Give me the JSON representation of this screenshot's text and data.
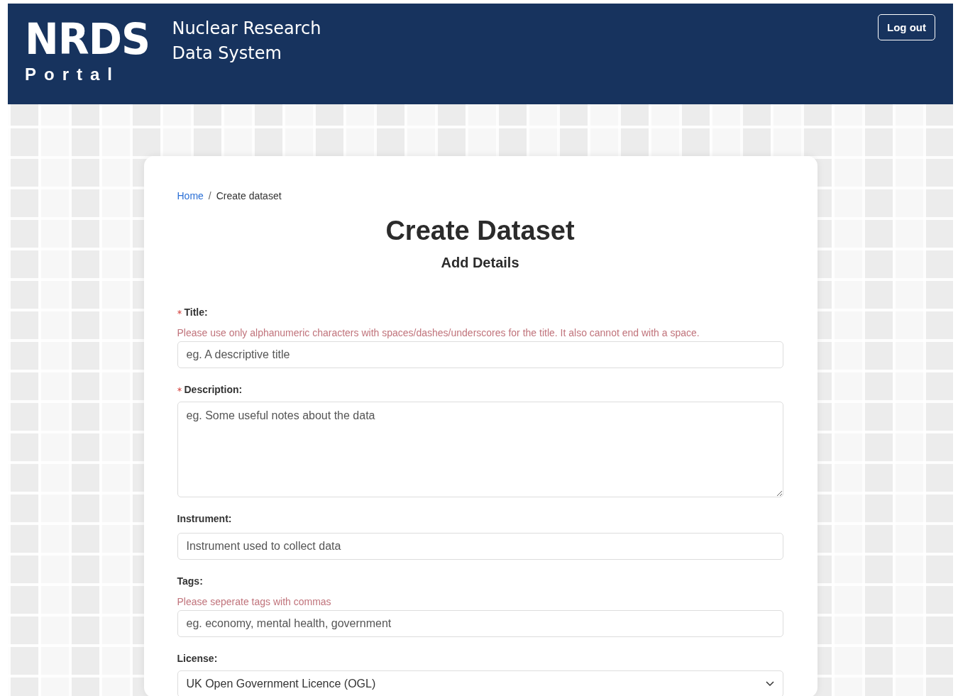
{
  "header": {
    "logo": "NRDS",
    "logo_subtitle": "Portal",
    "system_name": "Nuclear Research Data System",
    "logout_button": "Log out"
  },
  "breadcrumb": [
    {
      "label": "Home",
      "kind": "link"
    },
    {
      "label": "Create dataset",
      "kind": "current"
    }
  ],
  "separator": "/",
  "title": "Create Dataset",
  "subtitle": "Add Details",
  "fields": [
    {
      "kind": "input",
      "label": "Title:",
      "required": true,
      "hint": "Please use only alphanumeric characters with spaces/dashes/underscores for the title. It also cannot end with a space.",
      "placeholder": "eg. A descriptive title"
    },
    {
      "kind": "textarea",
      "label": "Description:",
      "required": true,
      "placeholder": "eg. Some useful notes about the data"
    },
    {
      "kind": "input",
      "label": "Instrument:",
      "required": false,
      "placeholder": "Instrument used to collect data"
    },
    {
      "kind": "input",
      "label": "Tags:",
      "required": false,
      "hint": "Please seperate tags with commas",
      "placeholder": "eg. economy, mental health, government"
    },
    {
      "kind": "select",
      "label": "License:",
      "required": false,
      "value": "UK Open Government Licence (OGL)"
    }
  ]
}
